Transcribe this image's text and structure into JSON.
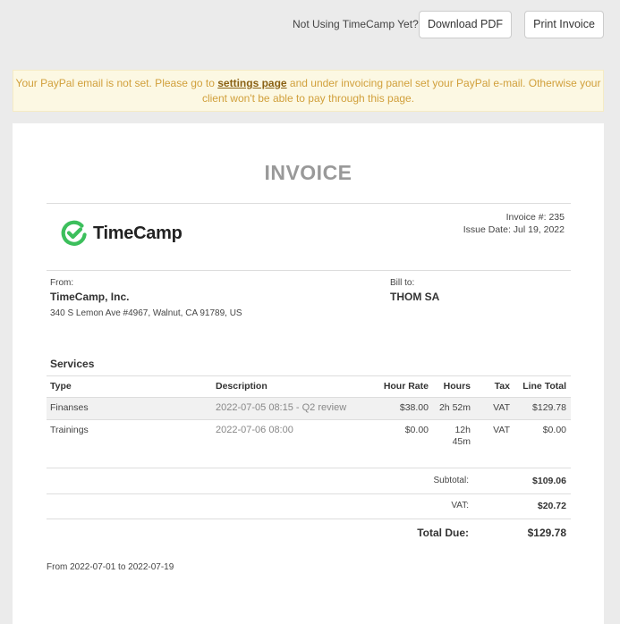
{
  "topbar": {
    "not_using_text": "Not Using TimeCamp Yet?",
    "download_pdf_label": "Download PDF",
    "print_invoice_label": "Print Invoice"
  },
  "alert": {
    "text_before": "Your PayPal email is not set. Please go to ",
    "link_text": "settings page",
    "text_after": " and under invoicing panel set your PayPal e-mail. Otherwise your client won't be able to pay through this page."
  },
  "invoice": {
    "title": "INVOICE",
    "logo_text": "TimeCamp",
    "number_label": "Invoice #: 235",
    "issue_date_label": "Issue Date: Jul 19, 2022",
    "from_label": "From:",
    "from_name": "TimeCamp, Inc.",
    "from_address": "340 S Lemon Ave #4967, Walnut, CA 91789, US",
    "bill_to_label": "Bill to:",
    "bill_to_name": "THOM SA",
    "services_title": "Services",
    "columns": {
      "type": "Type",
      "description": "Description",
      "hour_rate": "Hour Rate",
      "hours": "Hours",
      "tax": "Tax",
      "line_total": "Line Total"
    },
    "rows": [
      {
        "type": "Finanses",
        "description": "2022-07-05 08:15 - Q2 review",
        "hour_rate": "$38.00",
        "hours": "2h 52m",
        "tax": "VAT",
        "line_total": "$129.78"
      },
      {
        "type": "Trainings",
        "description": "2022-07-06 08:00",
        "hour_rate": "$0.00",
        "hours_line1": "12h",
        "hours_line2": "45m",
        "tax": "VAT",
        "line_total": "$0.00"
      }
    ],
    "summary": {
      "subtotal_label": "Subtotal:",
      "subtotal_value": "$109.06",
      "vat_label": "VAT:",
      "vat_value": "$20.72",
      "total_due_label": "Total Due:",
      "total_due_value": "$129.78"
    },
    "period_note": "From 2022-07-01 to 2022-07-19"
  },
  "colors": {
    "brand_green": "#3cbf5c",
    "alert_bg": "#fcf8e3",
    "alert_text": "#d1a03c"
  }
}
